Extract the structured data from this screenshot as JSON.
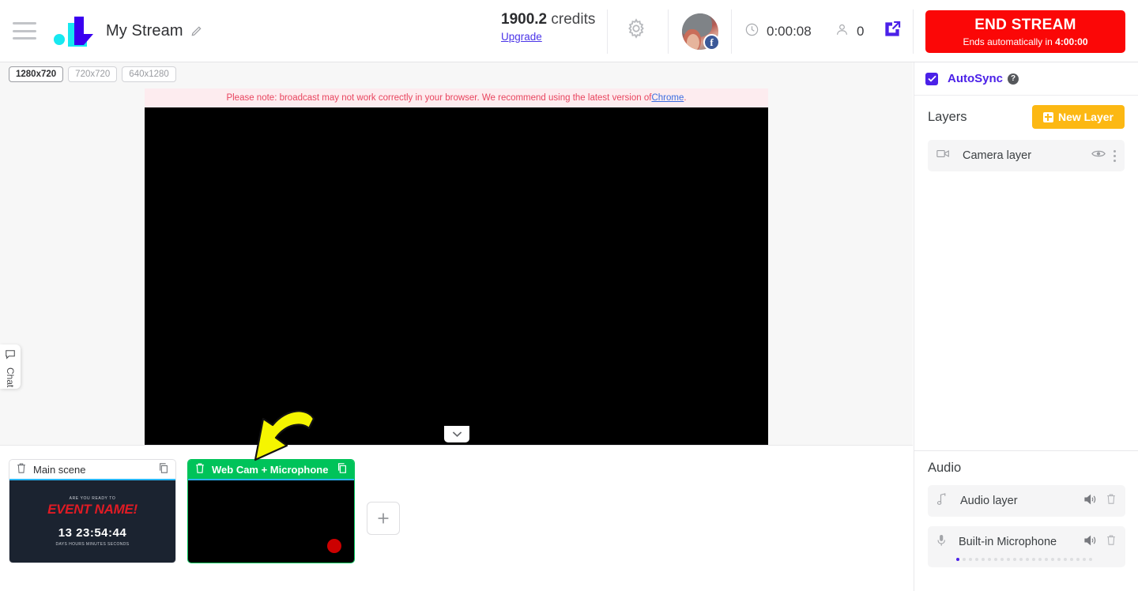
{
  "topbar": {
    "menu_icon": "hamburger-menu-icon",
    "logo_icon": "lightstream-logo-icon",
    "stream_title": "My Stream",
    "edit_icon": "pencil-edit-icon",
    "credits_value": "1900.2",
    "credits_label": "credits",
    "upgrade_link": "Upgrade",
    "settings_icon": "gear-icon",
    "avatar_name": "avatar",
    "social_badge": "f",
    "clock_icon": "clock-icon",
    "elapsed_time": "0:00:08",
    "viewers_icon": "person-icon",
    "viewers_count": "0",
    "popout_icon": "popout-external-link-icon",
    "end_stream_label": "END STREAM",
    "end_stream_sub_prefix": "Ends automatically in ",
    "end_stream_sub_time": "4:00:00",
    "accent_red": "#fb0707",
    "accent_purple": "#4b21e8"
  },
  "stage": {
    "resolutions": [
      {
        "label": "1280x720",
        "active": true
      },
      {
        "label": "720x720",
        "active": false
      },
      {
        "label": "640x1280",
        "active": false
      }
    ],
    "notice_text": "Please note: broadcast may not work correctly in your browser. We recommend using the latest version of ",
    "notice_link": "Chrome",
    "notice_suffix": ".",
    "collapse_icon": "chevron-down-icon",
    "chat_tab_icon": "chat-bubble-icon",
    "chat_tab_label": "Chat"
  },
  "scenes": {
    "items": [
      {
        "name": "Main scene",
        "active": false,
        "delete_icon": "trash-icon",
        "duplicate_icon": "copy-icon",
        "thumb": {
          "pretitle": "ARE YOU READY TO",
          "title": "EVENT NAME!",
          "countdown": "13 23:54:44",
          "labels": "DAYS   HOURS  MINUTES  SECONDS"
        }
      },
      {
        "name": "Web Cam + Microphone",
        "active": true,
        "delete_icon": "trash-icon",
        "duplicate_icon": "copy-icon",
        "thumb": {
          "recording_dot": "record-dot-icon"
        }
      }
    ],
    "add_scene_icon": "plus-icon"
  },
  "sidebar": {
    "autosync_label": "AutoSync",
    "autosync_checked": true,
    "autosync_help_icon": "help-question-icon",
    "layers_title": "Layers",
    "new_layer_label": "New Layer",
    "new_layer_color": "#fcb813",
    "layers": [
      {
        "name": "Camera layer",
        "type_icon": "camera-icon",
        "visibility_icon": "eye-icon",
        "menu_icon": "more-vertical-icon"
      }
    ],
    "audio_title": "Audio",
    "audio_items": [
      {
        "name": "Audio layer",
        "type_icon": "music-note-icon",
        "volume_icon": "speaker-icon",
        "delete_icon": "trash-icon",
        "has_meter": false,
        "meter_level": 0
      },
      {
        "name": "Built-in Microphone",
        "type_icon": "microphone-icon",
        "volume_icon": "speaker-icon",
        "delete_icon": "trash-icon",
        "has_meter": true,
        "meter_level": 1
      }
    ]
  },
  "annotation": {
    "arrow": "yellow-curved-arrow-pointing-to-active-scene"
  }
}
